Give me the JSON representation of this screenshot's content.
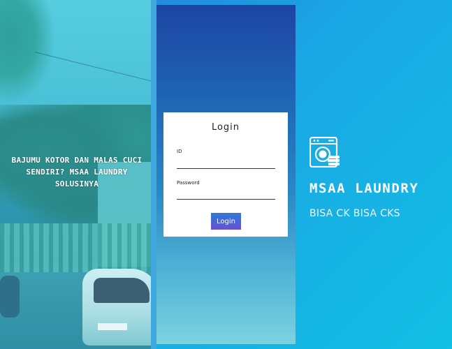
{
  "left_panel": {
    "tagline": "BAJUMU KOTOR DAN MALAS CUCI SENDIRI? MSAA LAUNDRY SOLUSINYA"
  },
  "login": {
    "title": "Login",
    "id_label": "ID",
    "id_value": "",
    "password_label": "Password",
    "password_value": "",
    "button_label": "Login"
  },
  "brand": {
    "icon": "washing-machine-icon",
    "name": "MSAA LAUNDRY",
    "slogan": "BISA CK BISA CKS"
  },
  "colors": {
    "button_top": "#2b7bd8",
    "button_bottom": "#6a4fd1",
    "center_top": "#1d45a3",
    "center_bottom": "#7cd2e1"
  }
}
